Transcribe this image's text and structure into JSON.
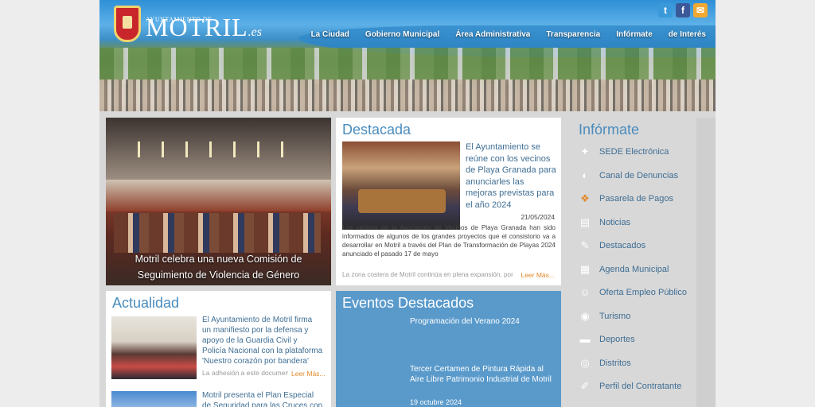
{
  "header": {
    "logo_small": "AYUNTAMIENTO DE",
    "logo_big": "MOTRIL",
    "logo_suffix": ".es",
    "social": [
      {
        "name": "twitter-icon",
        "glyph": "t",
        "color": "#3a9ad9"
      },
      {
        "name": "facebook-icon",
        "glyph": "f",
        "color": "#3b5998"
      },
      {
        "name": "chat-icon",
        "glyph": "✉",
        "color": "#f0a830"
      }
    ],
    "nav": [
      "La Ciudad",
      "Gobierno Municipal",
      "Área Administrativa",
      "Transparencia",
      "Infórmate",
      "de Interés"
    ]
  },
  "hero": {
    "caption_line1": "Motril celebra una nueva Comisión de",
    "caption_line2": "Seguimiento de Violencia de Género"
  },
  "destacada": {
    "title": "Destacada",
    "headline": "El Ayuntamiento se reúne con los vecinos de Playa Granada para anunciarles las mejoras previstas para el año 2024",
    "date": "21/05/2024",
    "body": "Los vecinos de la Asociación de Vecinos de Playa Granada han sido informados de algunos de los grandes proyectos que el consistorio va a desarrollar en Motril a través del Plan de Transformación de Playas 2024 anunciado el pasado 17 de mayo",
    "fade": "La zona costera de Motril continúa en plena expansión, por",
    "read_more": "Leer Más..."
  },
  "actualidad": {
    "title": "Actualidad",
    "items": [
      {
        "text": "El Ayuntamiento de Motril firma un manifiesto por la defensa y apoyo de la Guardia Civil y Policía Nacional con la plataforma 'Nuestro corazón por bandera'",
        "fade": "La adhesión a este documento",
        "read_more": "Leer Más..."
      },
      {
        "text": "Motril presenta el Plan Especial de Seguridad para las Cruces con la"
      }
    ]
  },
  "eventos": {
    "title": "Eventos Destacados",
    "items": [
      {
        "title": "Programación del Verano 2024",
        "date": ""
      },
      {
        "title": "Tercer Certamen de Pintura Rápida al Aire Libre Patrimonio Industrial de Motril",
        "date": "19 octubre 2024"
      }
    ]
  },
  "sidebar": {
    "title": "Infórmate",
    "items": [
      {
        "label": "SEDE Electrónica",
        "icon": "network-icon",
        "glyph": "✦"
      },
      {
        "label": "Canal de Denuncias",
        "icon": "megaphone-icon",
        "glyph": "◐"
      },
      {
        "label": "Pasarela de Pagos",
        "icon": "payment-hand-icon",
        "glyph": "❖",
        "accent": true
      },
      {
        "label": "Noticias",
        "icon": "newspaper-icon",
        "glyph": "▤"
      },
      {
        "label": "Destacados",
        "icon": "edit-icon",
        "glyph": "✎"
      },
      {
        "label": "Agenda Municipal",
        "icon": "calendar-icon",
        "glyph": "▦"
      },
      {
        "label": "Oferta Empleo Público",
        "icon": "people-icon",
        "glyph": "☺"
      },
      {
        "label": "Turismo",
        "icon": "eye-icon",
        "glyph": "◉"
      },
      {
        "label": "Deportes",
        "icon": "shoe-icon",
        "glyph": "▬"
      },
      {
        "label": "Distritos",
        "icon": "map-pin-icon",
        "glyph": "◎"
      },
      {
        "label": "Perfil del Contratante",
        "icon": "document-icon",
        "glyph": "✐"
      }
    ]
  }
}
